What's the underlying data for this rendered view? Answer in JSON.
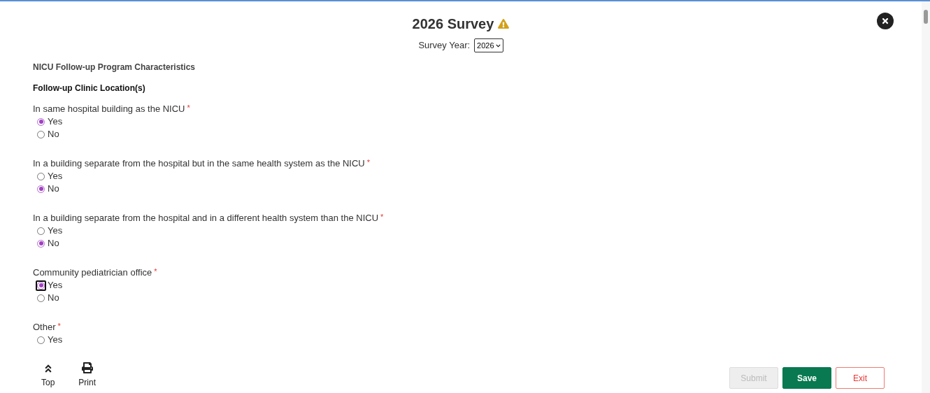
{
  "header": {
    "title": "2026 Survey",
    "year_label": "Survey Year:",
    "year_value": "2026"
  },
  "section_title": "NICU Follow-up Program Characteristics",
  "subsection_title": "Follow-up Clinic Location(s)",
  "questions": [
    {
      "label": "In same hospital building as the NICU",
      "required_mark": "*",
      "options": [
        {
          "label": "Yes",
          "selected": true,
          "focused": false
        },
        {
          "label": "No",
          "selected": false,
          "focused": false
        }
      ]
    },
    {
      "label": "In a building separate from the hospital but in the same health system as the NICU",
      "required_mark": "*",
      "options": [
        {
          "label": "Yes",
          "selected": false,
          "focused": false
        },
        {
          "label": "No",
          "selected": true,
          "focused": false
        }
      ]
    },
    {
      "label": "In a building separate from the hospital and in a different health system than the NICU",
      "required_mark": "*",
      "options": [
        {
          "label": "Yes",
          "selected": false,
          "focused": false
        },
        {
          "label": "No",
          "selected": true,
          "focused": false
        }
      ]
    },
    {
      "label": "Community pediatrician office",
      "required_mark": "*",
      "options": [
        {
          "label": "Yes",
          "selected": true,
          "focused": true
        },
        {
          "label": "No",
          "selected": false,
          "focused": false
        }
      ]
    },
    {
      "label": "Other",
      "required_mark": "*",
      "options": [
        {
          "label": "Yes",
          "selected": false,
          "focused": false
        }
      ]
    }
  ],
  "footer_links": [
    {
      "kind": "top",
      "label": "Top"
    },
    {
      "kind": "print",
      "label": "Print"
    }
  ],
  "buttons": [
    {
      "label": "Submit",
      "kind": "submit",
      "disabled": true
    },
    {
      "label": "Save",
      "kind": "save",
      "disabled": false
    },
    {
      "label": "Exit",
      "kind": "exit",
      "disabled": false
    }
  ]
}
